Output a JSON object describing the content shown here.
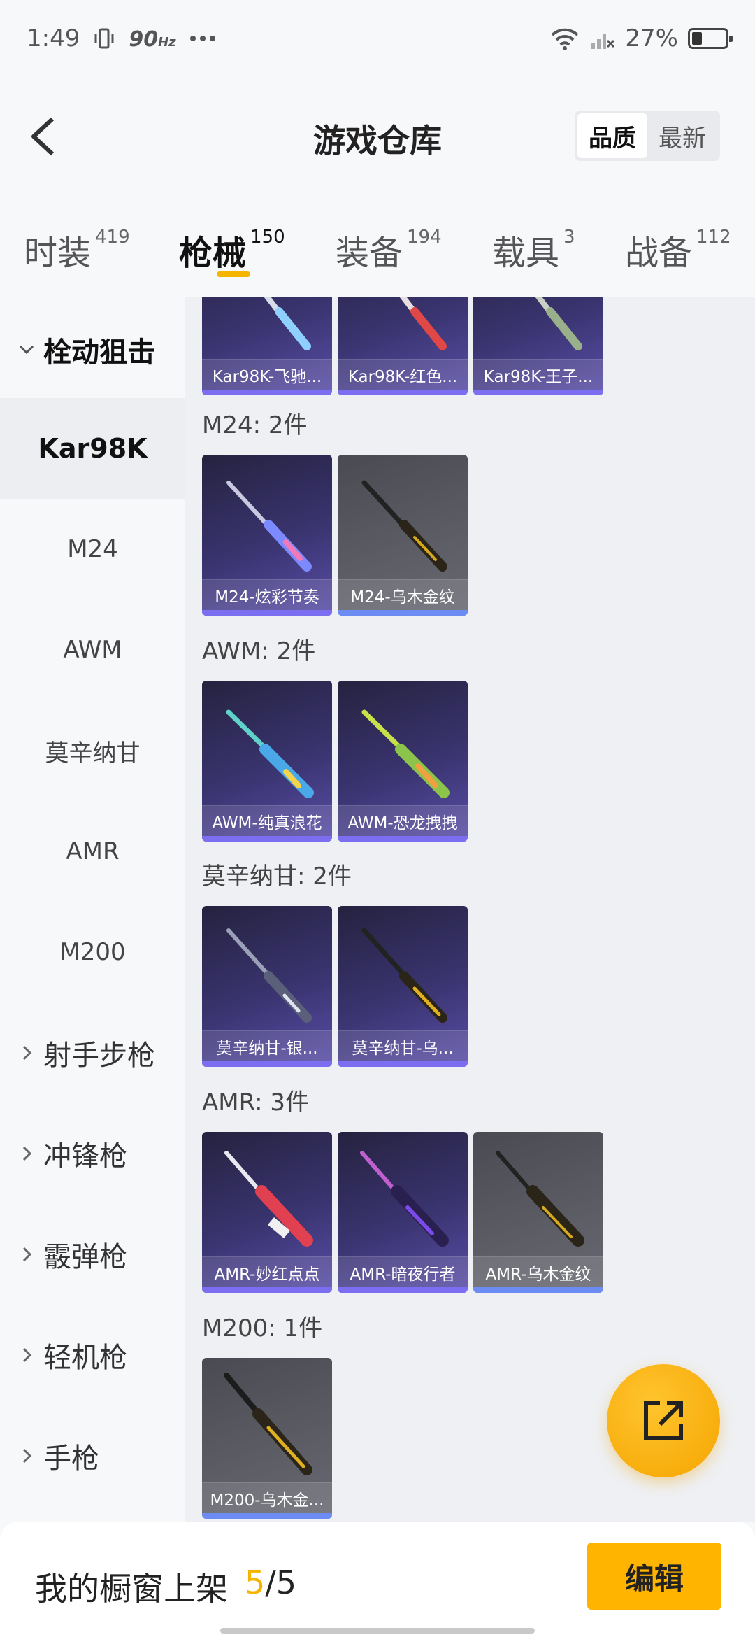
{
  "status_bar": {
    "time": "1:49",
    "hz": "90",
    "hz_unit": "Hz",
    "battery": "27%"
  },
  "header": {
    "title": "游戏仓库",
    "sort_options": [
      "品质",
      "最新"
    ],
    "sort_selected": "品质"
  },
  "tabs": [
    {
      "label": "时装",
      "count": "419"
    },
    {
      "label": "枪械",
      "count": "150"
    },
    {
      "label": "装备",
      "count": "194"
    },
    {
      "label": "载具",
      "count": "3"
    },
    {
      "label": "战备",
      "count": "112"
    }
  ],
  "sidebar": {
    "group_expanded": "栓动狙击",
    "items": [
      "Kar98K",
      "M24",
      "AWM",
      "莫辛纳甘",
      "AMR",
      "M200"
    ],
    "selected": "Kar98K",
    "groups_collapsed": [
      "射手步枪",
      "冲锋枪",
      "霰弹枪",
      "轻机枪",
      "手枪"
    ]
  },
  "sections": [
    {
      "title": "",
      "items": [
        "Kar98K-飞驰...",
        "Kar98K-红色...",
        "Kar98K-王子..."
      ]
    },
    {
      "title": "M24: 2件",
      "items": [
        "M24-炫彩节奏",
        "M24-乌木金纹"
      ]
    },
    {
      "title": "AWM: 2件",
      "items": [
        "AWM-纯真浪花",
        "AWM-恐龙拽拽"
      ]
    },
    {
      "title": "莫辛纳甘: 2件",
      "items": [
        "莫辛纳甘-银...",
        "莫辛纳甘-乌..."
      ]
    },
    {
      "title": "AMR: 3件",
      "items": [
        "AMR-妙红点点",
        "AMR-暗夜行者",
        "AMR-乌木金纹"
      ]
    },
    {
      "title": "M200: 1件",
      "items": [
        "M200-乌木金..."
      ]
    }
  ],
  "bottom_bar": {
    "label": "我的橱窗上架",
    "count_current": "5",
    "count_sep": "/",
    "count_total": "5",
    "edit_label": "编辑"
  },
  "colors": {
    "accent": "#f5b400",
    "card_purple": "#3a3470",
    "card_grey": "#5d5d66"
  }
}
